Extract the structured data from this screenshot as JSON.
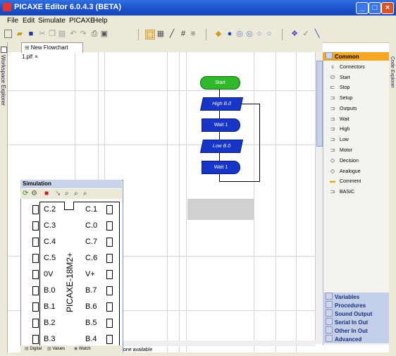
{
  "window": {
    "title": "PICAXE Editor 6.0.4.3 (BETA)"
  },
  "menu": [
    "File",
    "Edit",
    "Simulate",
    "PICAXE",
    "Help"
  ],
  "document_tab": {
    "label": "New Flowchart 1.plf"
  },
  "left_dock": {
    "label": "Workspace Explorer"
  },
  "right_dock": {
    "label": "Code Explorer"
  },
  "flowchart": {
    "blocks": [
      {
        "id": "start",
        "kind": "terminal",
        "label": "Start"
      },
      {
        "id": "high",
        "kind": "output",
        "label": "High B.0"
      },
      {
        "id": "wait1",
        "kind": "wait",
        "label": "Wait 1"
      },
      {
        "id": "low",
        "kind": "output",
        "label": "Low B.0"
      },
      {
        "id": "wait2",
        "kind": "wait",
        "label": "Wait 1"
      }
    ]
  },
  "palette": {
    "header": "Common",
    "items": [
      {
        "label": "Connectors",
        "icon": "connector-icon"
      },
      {
        "label": "Start",
        "icon": "start-icon"
      },
      {
        "label": "Stop",
        "icon": "stop-icon"
      },
      {
        "label": "Setup",
        "icon": "setup-icon"
      },
      {
        "label": "Outputs",
        "icon": "outputs-icon"
      },
      {
        "label": "Wait",
        "icon": "wait-icon"
      },
      {
        "label": "High",
        "icon": "high-icon"
      },
      {
        "label": "Low",
        "icon": "low-icon"
      },
      {
        "label": "Motor",
        "icon": "motor-icon"
      },
      {
        "label": "Decision",
        "icon": "decision-icon"
      },
      {
        "label": "Analogue",
        "icon": "analogue-icon"
      },
      {
        "label": "Comment",
        "icon": "comment-icon"
      },
      {
        "label": "BASIC",
        "icon": "basic-icon"
      }
    ],
    "categories": [
      "Variables",
      "Procedures",
      "Sound Output",
      "Serial In Out",
      "Other In Out",
      "Advanced"
    ]
  },
  "simulation": {
    "title": "Simulation",
    "chip_name": "PICAXE-18M2+",
    "left_pins": [
      "C.2",
      "C.3",
      "C.4",
      "C.5",
      "0V",
      "B.0",
      "B.1",
      "B.2",
      "B.3"
    ],
    "right_pins": [
      "C.1",
      "C.0",
      "C.7",
      "C.6",
      "V+",
      "B.7",
      "B.6",
      "B.5",
      "B.4"
    ],
    "tabs": [
      "Digital",
      "Values",
      "Watch"
    ]
  },
  "status": {
    "text": "one available"
  },
  "colors": {
    "title_bar": "#1b4fc8",
    "start_block": "#2fb82a",
    "block": "#1735c8",
    "palette_header": "#f5a623"
  }
}
